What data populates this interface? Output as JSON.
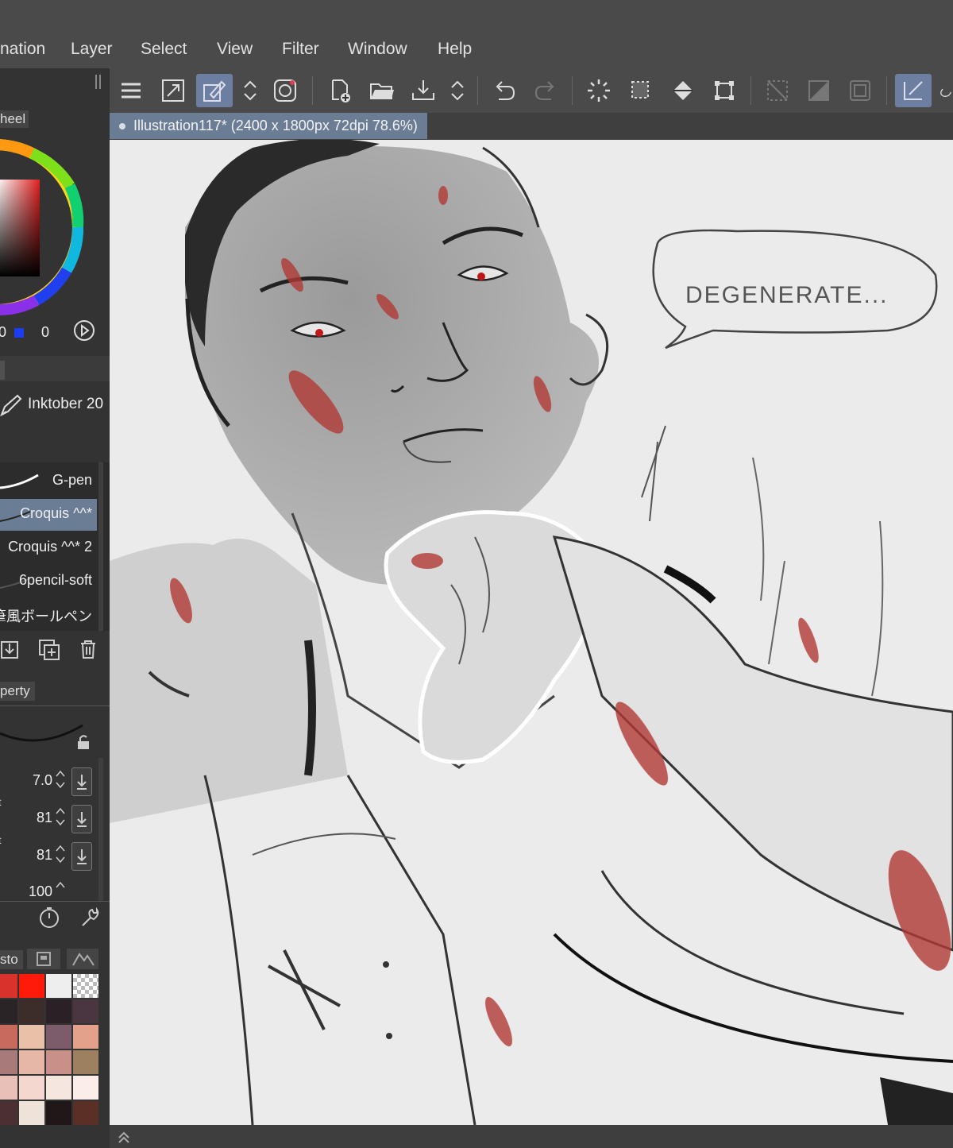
{
  "menu": {
    "items": [
      "nation",
      "Layer",
      "Select",
      "View",
      "Filter",
      "Window",
      "Help"
    ]
  },
  "left_panel": {
    "color_wheel_tab": "heel",
    "color_values": {
      "v1": "0",
      "v2": "0"
    },
    "subtool_group": "Inktober 20",
    "brushes": [
      {
        "label": "G-pen",
        "selected": false
      },
      {
        "label": "Croquis ^^*",
        "selected": true
      },
      {
        "label": "Croquis ^^* 2",
        "selected": false
      },
      {
        "label": "6pencil-soft",
        "selected": false
      },
      {
        "label": "鉛筆風ボールペン",
        "selected": false
      }
    ],
    "property_tab": "perty",
    "properties": [
      {
        "label": "",
        "value": "7.0"
      },
      {
        "label": "t",
        "value": "81"
      },
      {
        "label": "t",
        "value": "81"
      },
      {
        "label": "",
        "value": "100"
      }
    ],
    "palette_tab": "sto"
  },
  "document": {
    "tab_title": "Illustration117* (2400 x 1800px 72dpi 78.6%)"
  },
  "canvas": {
    "speech_bubble_text": "DEGENERATE..."
  },
  "colors": {
    "accent_selected": "#6b7c95",
    "panel_bg": "#333333",
    "toolbar_bg": "#4a4a4a",
    "canvas_bg": "#ebebeb",
    "blood_red": "#b23a36"
  },
  "palette": [
    [
      "#d8322b",
      "#ff1a0a",
      "#eeeeee",
      "checker"
    ],
    [
      "#2b2426",
      "#3c2d2b",
      "#2a2026",
      "#4a3640"
    ],
    [
      "#c86a5c",
      "#e9c0a8",
      "#7c5c6a",
      "#e3a08a"
    ],
    [
      "#a87a7a",
      "#e6b6a6",
      "#c89088",
      "#9c8060"
    ],
    [
      "#e8c0b8",
      "#f4d8d0",
      "#f6e6e0",
      "#fbeee8"
    ],
    [
      "#4a3032",
      "#efe2d8",
      "#201818",
      "#5a3026"
    ]
  ]
}
